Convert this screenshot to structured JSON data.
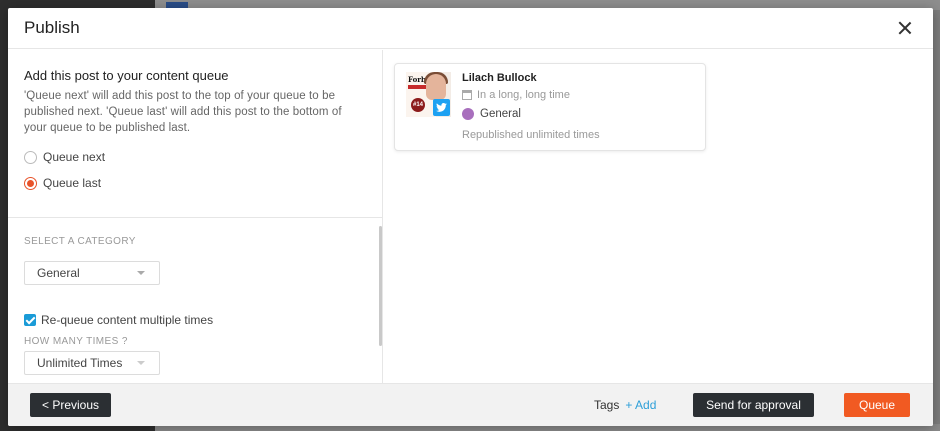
{
  "modal": {
    "title": "Publish"
  },
  "queue": {
    "title": "Add this post to your content queue",
    "description": "'Queue next' will add this post to the top of your queue to be published next. 'Queue last' will add this post to the bottom of your queue to be published last.",
    "options": [
      {
        "label": "Queue next",
        "checked": false
      },
      {
        "label": "Queue last",
        "checked": true
      }
    ]
  },
  "category": {
    "heading": "SELECT A CATEGORY",
    "selected": "General",
    "requeue_label": "Re-queue content multiple times",
    "requeue_checked": true,
    "how_many_heading": "HOW MANY TIMES ?",
    "times_selected": "Unlimited Times"
  },
  "post": {
    "author": "Lilach Bullock",
    "time": "In a long, long time",
    "category": "General",
    "category_color": "#a86fbd",
    "republished": "Republished unlimited times",
    "thumb_text": "Forbes",
    "thumb_badge": "#14",
    "network_icon": "twitter-icon"
  },
  "footer": {
    "previous_label": "< Previous",
    "tags_label": "Tags",
    "tags_add_label": "+ Add",
    "approval_label": "Send for approval",
    "queue_label": "Queue"
  },
  "colors": {
    "accent_orange": "#f15a22",
    "link_blue": "#2d9fd8",
    "checkbox_blue": "#1a9bd7",
    "dark_button": "#2b2f33"
  }
}
